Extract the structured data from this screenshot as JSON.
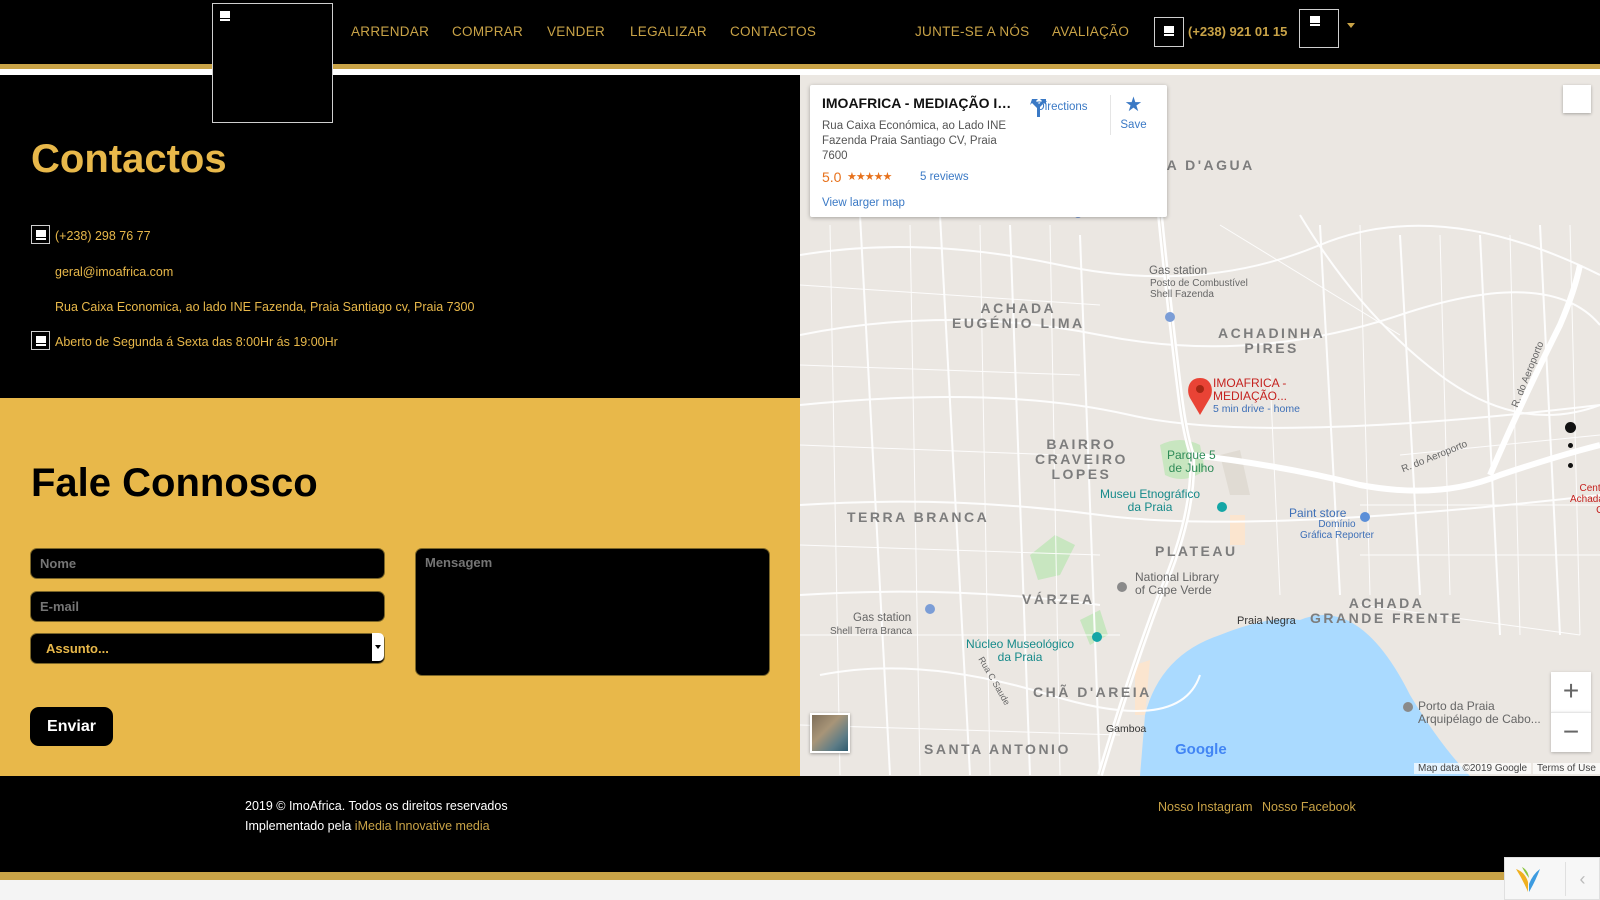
{
  "header": {
    "nav": [
      {
        "label": "ARRENDAR"
      },
      {
        "label": "COMPRAR"
      },
      {
        "label": "VENDER"
      },
      {
        "label": "LEGALIZAR"
      },
      {
        "label": "CONTACTOS"
      }
    ],
    "nav_right": [
      {
        "label": "JUNTE-SE A NÓS"
      },
      {
        "label": "AVALIAÇÃO"
      }
    ],
    "phone": "(+238) 921 01 15",
    "accent_color": "#c9a347"
  },
  "contacts": {
    "title": "Contactos",
    "phone": "(+238) 298 76 77",
    "email": "geral@imoafrica.com",
    "address": "Rua Caixa Economica, ao lado INE Fazenda, Praia Santiago cv, Praia 7300",
    "hours": "Aberto de Segunda á Sexta das 8:00Hr ás 19:00Hr"
  },
  "form": {
    "title": "Fale Connosco",
    "name_placeholder": "Nome",
    "email_placeholder": "E-mail",
    "subject_selected": "Assunto...",
    "message_placeholder": "Mensagem",
    "submit_label": "Enviar",
    "background_color": "#e8b84a"
  },
  "map": {
    "card": {
      "title": "IMOAFRICA - MEDIAÇÃO IMO...",
      "address": "Rua Caixa Económica, ao Lado INE Fazenda Praia Santiago CV, Praia 7600",
      "rating": "5.0",
      "stars": "★★★★★",
      "reviews": "5 reviews",
      "larger_map": "View larger map",
      "directions": "Directions",
      "save": "Save"
    },
    "neighbourhoods": {
      "santa_agua": "NTA D'AGUA",
      "achada_eugenio": "ACHADA\nEUGÉNIO LIMA",
      "achadinha": "ACHADINHA\nPIRES",
      "bairro": "BAIRRO\nCRAVEIRO\nLOPES",
      "terra_branca": "TERRA BRANCA",
      "plateau": "PLATEAU",
      "varzea": "VÁRZEA",
      "achada_grande": "ACHADA\nGRANDE FRENTE",
      "cha_areia": "CHÃ D'AREIA",
      "santa_antonio": "SANTA ANTONIO"
    },
    "pois": {
      "gas1": "Gas station",
      "gas1_sub": "Posto de Combustível\nShell Fazenda",
      "pin_label": "IMOAFRICA -\nMEDIAÇÃO...",
      "pin_sub": "5 min drive - home",
      "parque": "Parque 5\nde Julho",
      "museu": "Museu Etnográfico\nda Praia",
      "paint": "Paint store",
      "paint_sub": "Domínio\nGráfica Reporter",
      "library": "National Library\nof Cape Verde",
      "gas2": "Gas station",
      "gas2_sub": "Shell Terra Branca",
      "nucleo": "Núcleo Museológico\nda Praia",
      "praia_negra": "Praia Negra",
      "porto": "Porto da Praia\nArquipélago de Cabo...",
      "gamboa": "Gamboa",
      "centro": "Centr\nAchada G",
      "aeroporto": "R. do Aeroporto",
      "aeroporto2": "R. do Aeroporto",
      "rua_saude": "Rua C Saude"
    },
    "google": "Google",
    "map_data": "Map data ©2019 Google",
    "terms": "Terms of Use",
    "zoom_in": "+",
    "zoom_out": "−"
  },
  "footer": {
    "copyright": "2019 © ImoAfrica. Todos os direitos reservados",
    "implemented_prefix": "Implementado pela ",
    "implemented_link": "iMedia Innovative media",
    "instagram": "Nosso Instagram",
    "facebook": "Nosso Facebook"
  },
  "toolbar": {
    "toggle": "‹"
  }
}
